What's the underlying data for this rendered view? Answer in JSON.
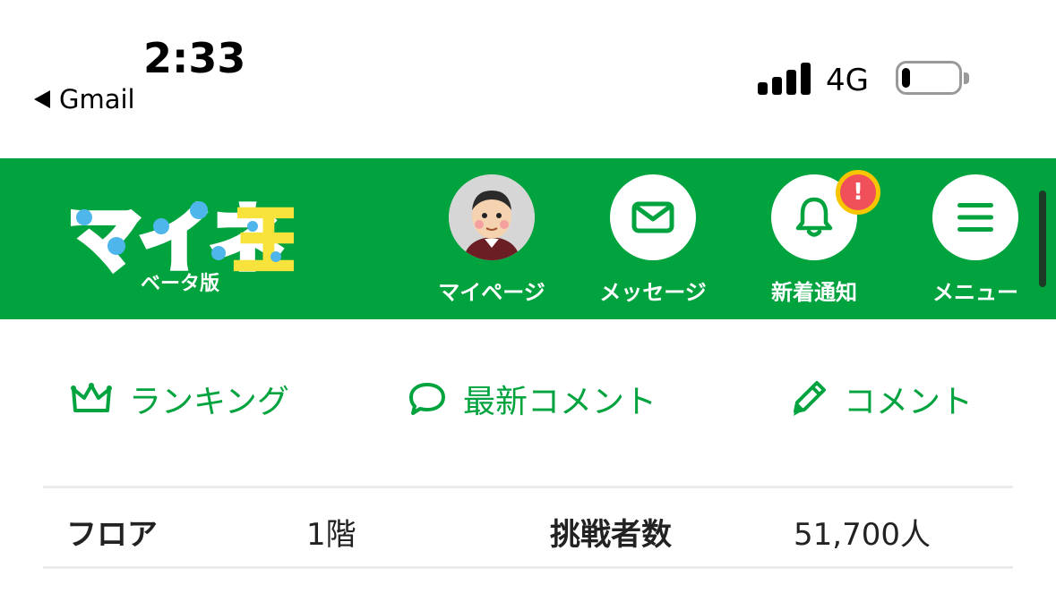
{
  "status_bar": {
    "time": "2:33",
    "back_label": "Gmail",
    "network": "4G",
    "battery_level": 0.15
  },
  "header": {
    "logo_text": "マイネ王",
    "beta_label": "ベータ版",
    "nav": {
      "mypage": "マイページ",
      "message": "メッセージ",
      "notification": "新着通知",
      "notification_badge": "!",
      "menu": "メニュー"
    },
    "colors": {
      "brand_green": "#00a33e",
      "badge_red": "#f0505a",
      "badge_ring": "#f7c600"
    }
  },
  "subnav": {
    "ranking": "ランキング",
    "latest_comments": "最新コメント",
    "comment": "コメント"
  },
  "info_table": {
    "floor_label": "フロア",
    "floor_value": "1階",
    "challengers_label": "挑戦者数",
    "challengers_value": "51,700人"
  },
  "icons": [
    "back-arrow-icon",
    "signal-icon",
    "battery-icon",
    "avatar",
    "mail-icon",
    "bell-icon",
    "hamburger-icon",
    "crown-icon",
    "speech-bubble-icon",
    "pencil-icon"
  ]
}
